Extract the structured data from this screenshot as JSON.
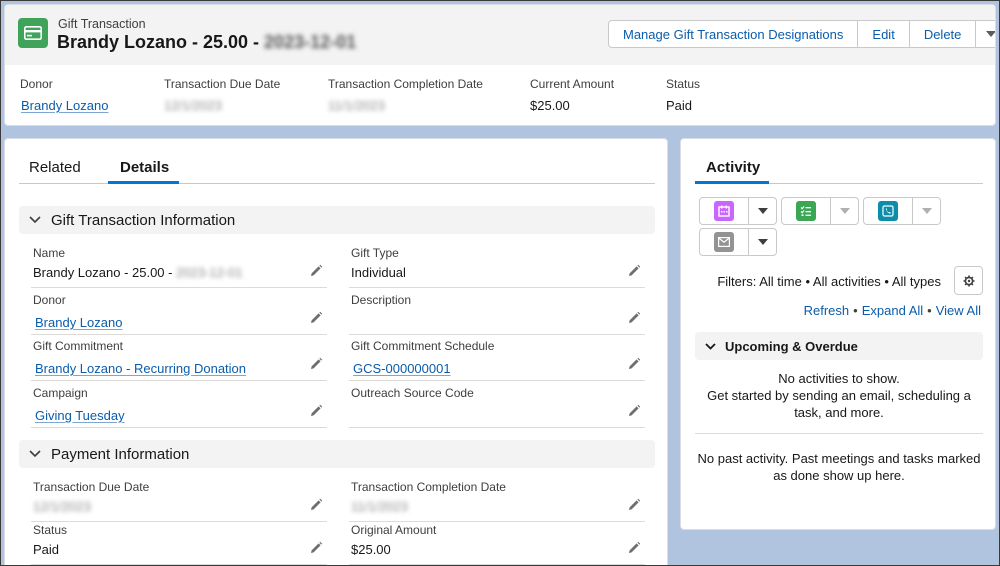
{
  "header": {
    "object_label": "Gift Transaction",
    "title_prefix": "Brandy Lozano - 25.00 - ",
    "title_date": "2023-12-01",
    "buttons": {
      "manage": "Manage Gift Transaction Designations",
      "edit": "Edit",
      "delete": "Delete"
    }
  },
  "highlights": {
    "donor": {
      "label": "Donor",
      "value": "Brandy Lozano"
    },
    "due_date": {
      "label": "Transaction Due Date",
      "value": "12/1/2023"
    },
    "completion_date": {
      "label": "Transaction Completion Date",
      "value": "11/1/2023"
    },
    "current_amount": {
      "label": "Current Amount",
      "value": "$25.00"
    },
    "status": {
      "label": "Status",
      "value": "Paid"
    }
  },
  "tabs": {
    "related": "Related",
    "details": "Details"
  },
  "sections": {
    "gift_info": {
      "title": "Gift Transaction Information",
      "name": {
        "label": "Name",
        "prefix": "Brandy Lozano - 25.00 - ",
        "date": "2023-12-01"
      },
      "gift_type": {
        "label": "Gift Type",
        "value": "Individual"
      },
      "donor": {
        "label": "Donor",
        "value": "Brandy Lozano"
      },
      "description": {
        "label": "Description",
        "value": ""
      },
      "gift_commitment": {
        "label": "Gift Commitment",
        "value": "Brandy Lozano - Recurring Donation"
      },
      "commitment_schedule": {
        "label": "Gift Commitment Schedule",
        "value": "GCS-000000001"
      },
      "campaign": {
        "label": "Campaign",
        "value": "Giving Tuesday"
      },
      "outreach": {
        "label": "Outreach Source Code",
        "value": ""
      }
    },
    "payment_info": {
      "title": "Payment Information",
      "due_date": {
        "label": "Transaction Due Date",
        "value": "12/1/2023"
      },
      "completion_date": {
        "label": "Transaction Completion Date",
        "value": "11/1/2023"
      },
      "status": {
        "label": "Status",
        "value": "Paid"
      },
      "original_amount": {
        "label": "Original Amount",
        "value": "$25.00"
      }
    }
  },
  "activity": {
    "tab": "Activity",
    "filters": "Filters: All time • All activities • All types",
    "links": {
      "refresh": "Refresh",
      "expand": "Expand All",
      "view": "View All"
    },
    "upcoming_title": "Upcoming & Overdue",
    "no_activities": "No activities to show.",
    "get_started": "Get started by sending an email, scheduling a task, and more.",
    "no_past": "No past activity. Past meetings and tasks marked as done show up here.",
    "icons": {
      "event": "calendar-icon",
      "task": "task-list-icon",
      "call": "phone-icon",
      "email": "email-icon"
    }
  },
  "colors": {
    "record_icon": "#3fa45a",
    "event": "#cb65ff",
    "task": "#3ba755",
    "call": "#0c8eab",
    "email": "#939393",
    "link": "#0b5cab",
    "accent": "#0176d3"
  }
}
